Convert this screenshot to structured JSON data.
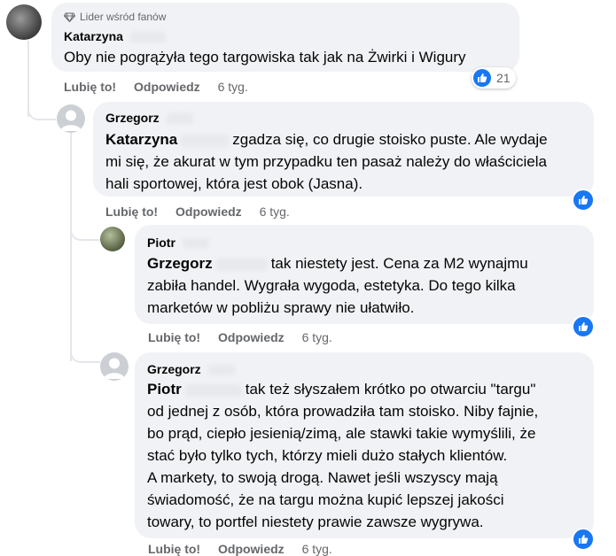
{
  "comments": [
    {
      "badge": "Lider wśród fanów",
      "author": "Katarzyna",
      "text": "Oby nie pogrążyła tego targowiska tak jak na Żwirki i Wigury",
      "actions": {
        "like": "Lubię to!",
        "reply": "Odpowiedz",
        "time": "6 tyg."
      },
      "reaction_count": "21"
    },
    {
      "author": "Grzegorz",
      "mention": "Katarzyna",
      "text_line1": "zgadza się, co drugie stoisko puste. Ale wydaje",
      "text_line2": "mi się, że akurat w tym przypadku ten pasaż należy do właściciela",
      "text_line3": "hali sportowej, która jest obok (Jasna).",
      "actions": {
        "like": "Lubię to!",
        "reply": "Odpowiedz",
        "time": "6 tyg."
      }
    },
    {
      "author": "Piotr",
      "mention": "Grzegorz",
      "text_line1": "tak niestety jest. Cena za M2 wynajmu",
      "text_line2": "zabiła handel. Wygrała wygoda, estetyka. Do tego kilka",
      "text_line3": "marketów w pobliżu sprawy nie ułatwiło.",
      "actions": {
        "like": "Lubię to!",
        "reply": "Odpowiedz",
        "time": "6 tyg."
      }
    },
    {
      "author": "Grzegorz",
      "mention": "Piotr",
      "text_line1": "tak też słyszałem krótko po otwarciu \"targu\"",
      "text_line2": "od jednej z osób, która prowadziła tam stoisko. Niby fajnie,",
      "text_line3": "bo prąd, ciepło jesienią/zimą, ale stawki takie wymyślili, że",
      "text_line4": "stać było tylko tych, którzy mieli dużo stałych klientów.",
      "text_line5": "A markety, to swoją drogą. Nawet jeśli wszyscy mają",
      "text_line6": "świadomość, że na targu można kupić lepszej jakości",
      "text_line7": "towary, to portfel niestety prawie zawsze wygrywa.",
      "actions": {
        "like": "Lubię to!",
        "reply": "Odpowiedz",
        "time": "6 tyg."
      }
    }
  ],
  "colors": {
    "bubble": "#f0f2f5",
    "like_blue": "#1877f2",
    "meta_gray": "#65676b"
  }
}
